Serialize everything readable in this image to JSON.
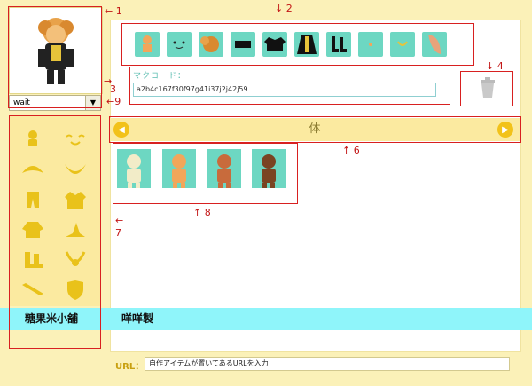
{
  "app": {
    "character_state": "wait",
    "code_label": "マクコード：",
    "code_value": "a2b4c167f30f97g41i37j2j42j59",
    "category_title": "体",
    "url_label": "URL：",
    "url_placeholder": "自作アイテムが置いてあるURLを入力"
  },
  "banner": {
    "shop_name": "糖果米小舖",
    "maker": "咩咩製"
  },
  "left_categories": [
    "body-icon",
    "face-icon",
    "hair-icon",
    "beard-icon",
    "pants-icon",
    "jacket-icon",
    "coat-icon",
    "hat-icon",
    "boots-icon",
    "necklace-icon",
    "sword-icon",
    "shield-icon"
  ],
  "equipped_items": [
    "body-icon",
    "face-icon",
    "hair-icon",
    "skirt-icon",
    "shirt-icon",
    "cloak-icon",
    "boots-icon",
    "hand-icon",
    "accessory-icon",
    "wing-icon"
  ],
  "skin_tones": [
    "#f2ecc8",
    "#f2a65a",
    "#c86b3c",
    "#7a4422"
  ],
  "annotations": {
    "a1": "← 1",
    "a2": "↓ 2",
    "a3": "3",
    "a4": "↓ 4",
    "a6": "↑   6",
    "a7": "←",
    "a7n": "7",
    "a8": "↑   8",
    "a9": "←9",
    "a3arrow": "→"
  },
  "colors": {
    "accent_yellow": "#f2c21a",
    "swatch_teal": "#6dd7c2",
    "annotation_red": "#c21414",
    "banner_cyan": "#8ff5fa"
  }
}
